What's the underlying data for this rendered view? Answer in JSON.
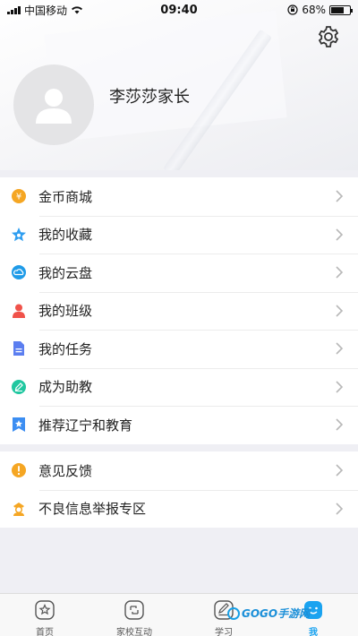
{
  "status_bar": {
    "carrier": "中国移动",
    "time": "09:40",
    "battery_percent": "68%",
    "battery_level": 0.68
  },
  "profile": {
    "username": "李莎莎家长"
  },
  "menu_section_1": [
    {
      "label": "金币商城",
      "icon": "coin-icon",
      "color": "#f5a623"
    },
    {
      "label": "我的收藏",
      "icon": "star-icon",
      "color": "#2f9ef0"
    },
    {
      "label": "我的云盘",
      "icon": "cloud-icon",
      "color": "#1f9be8"
    },
    {
      "label": "我的班级",
      "icon": "class-icon",
      "color": "#f0524a"
    },
    {
      "label": "我的任务",
      "icon": "task-icon",
      "color": "#5b7ef0"
    },
    {
      "label": "成为助教",
      "icon": "pencil-icon",
      "color": "#20c7a0"
    },
    {
      "label": "推荐辽宁和教育",
      "icon": "recommend-icon",
      "color": "#3c8ef2"
    }
  ],
  "menu_section_2": [
    {
      "label": "意见反馈",
      "icon": "feedback-icon",
      "color": "#f5a623"
    },
    {
      "label": "不良信息举报专区",
      "icon": "report-icon",
      "color": "#f5a623"
    }
  ],
  "tabs": [
    {
      "label": "首页",
      "icon": "home-icon",
      "active": false
    },
    {
      "label": "家校互动",
      "icon": "interaction-icon",
      "active": false
    },
    {
      "label": "学习",
      "icon": "study-icon",
      "active": false
    },
    {
      "label": "我",
      "icon": "me-icon",
      "active": true
    }
  ],
  "watermark": {
    "text": "GOGO手游网"
  },
  "colors": {
    "accent": "#1aa3f0",
    "background": "#efeff4"
  }
}
